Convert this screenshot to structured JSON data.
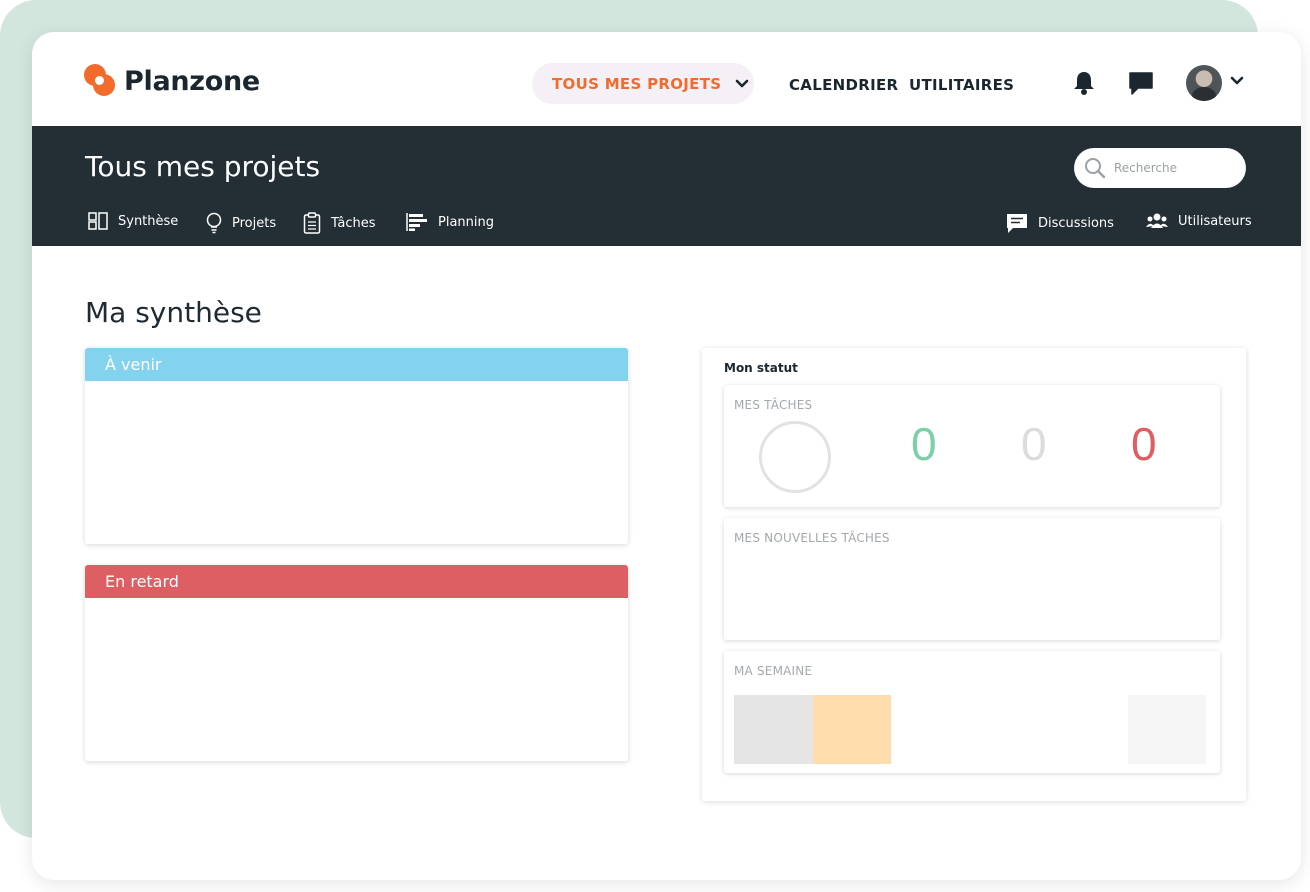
{
  "app": {
    "name": "Planzone"
  },
  "topnav": {
    "active": "TOUS MES PROJETS",
    "links": [
      "CALENDRIER",
      "UTILITAIRES"
    ]
  },
  "header": {
    "title": "Tous mes projets",
    "search_placeholder": "Recherche",
    "tabs": [
      "Synthèse",
      "Projets",
      "Tâches",
      "Planning"
    ],
    "right_tabs": [
      "Discussions",
      "Utilisateurs"
    ]
  },
  "main": {
    "title": "Ma synthèse",
    "upcoming": {
      "label": "À venir"
    },
    "late": {
      "label": "En retard"
    },
    "status": {
      "title": "Mon statut",
      "tasks": {
        "label": "MES TÂCHES",
        "counts": [
          "0",
          "0",
          "0"
        ]
      },
      "new_tasks": {
        "label": "MES NOUVELLES TÂCHES"
      },
      "week": {
        "label": "MA SEMAINE"
      }
    }
  },
  "colors": {
    "brand": "#f36b2c",
    "header_bg": "#232e35",
    "upcoming": "#84d3ee",
    "late": "#de5f63",
    "count_done": "#7dcfa5",
    "count_neutral": "#dcdcdc",
    "count_late": "#de5f63"
  },
  "icons": {
    "logo": "planzone-logo-icon",
    "bell": "bell-icon",
    "messages": "chat-icon",
    "search": "search-icon"
  }
}
